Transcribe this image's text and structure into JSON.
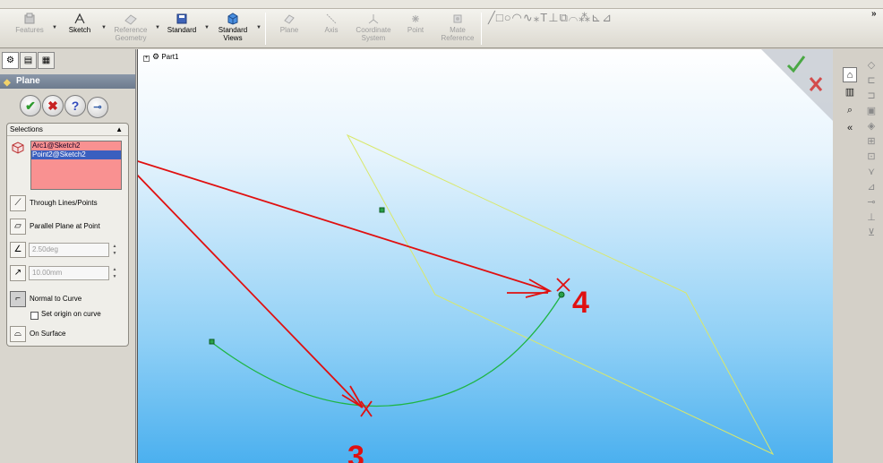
{
  "toolbar": {
    "items": [
      {
        "label": "Features",
        "icon": "features-icon",
        "enabled": false
      },
      {
        "label": "Sketch",
        "icon": "sketch-icon",
        "enabled": true
      },
      {
        "label": "Reference Geometry",
        "icon": "reference-geometry-icon",
        "enabled": false
      },
      {
        "label": "Standard",
        "icon": "standard-icon",
        "enabled": true
      },
      {
        "label": "Standard Views",
        "icon": "standard-views-icon",
        "enabled": true
      }
    ],
    "ref_items": [
      {
        "label": "Plane",
        "icon": "plane-icon"
      },
      {
        "label": "Axis",
        "icon": "axis-icon"
      },
      {
        "label": "Coordinate System",
        "icon": "coordinate-system-icon"
      },
      {
        "label": "Point",
        "icon": "point-icon"
      },
      {
        "label": "Mate Reference",
        "icon": "mate-reference-icon"
      }
    ],
    "expand": "»"
  },
  "panel": {
    "tabs": [
      "feature-manager-icon",
      "property-manager-icon",
      "configuration-manager-icon"
    ],
    "title": "Plane",
    "selections_header": "Selections",
    "selected_items": [
      "Arc1@Sketch2",
      "Point2@Sketch2"
    ],
    "options": {
      "through_lines": "Through Lines/Points",
      "parallel_plane": "Parallel Plane at Point",
      "angle_value": "2.50deg",
      "distance_value": "10.00mm",
      "normal_to_curve": "Normal to Curve",
      "set_origin": "Set origin on curve",
      "on_surface": "On Surface"
    }
  },
  "viewport": {
    "tree_root": "Part1",
    "annotations": [
      "3",
      "4"
    ]
  },
  "colors": {
    "annotation": "#e01010",
    "arc": "#1fb545",
    "plane": "#d9e86a",
    "selection_list_bg": "#f99191"
  }
}
